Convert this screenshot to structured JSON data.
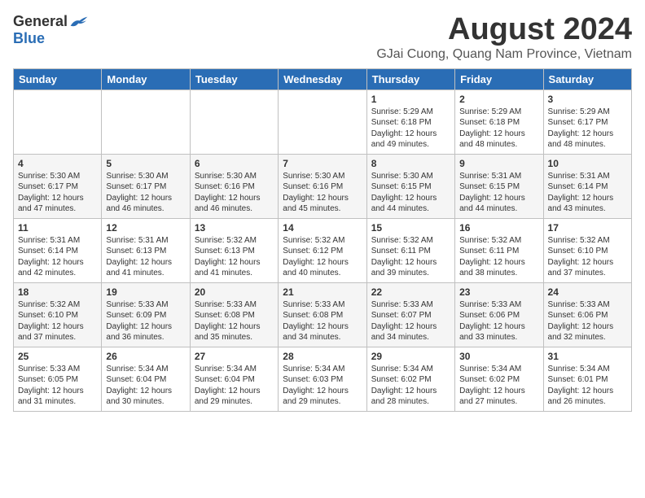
{
  "header": {
    "logo_general": "General",
    "logo_blue": "Blue",
    "month_title": "August 2024",
    "location": "GJai Cuong, Quang Nam Province, Vietnam"
  },
  "calendar": {
    "days_of_week": [
      "Sunday",
      "Monday",
      "Tuesday",
      "Wednesday",
      "Thursday",
      "Friday",
      "Saturday"
    ],
    "weeks": [
      [
        {
          "day": "",
          "info": ""
        },
        {
          "day": "",
          "info": ""
        },
        {
          "day": "",
          "info": ""
        },
        {
          "day": "",
          "info": ""
        },
        {
          "day": "1",
          "info": "Sunrise: 5:29 AM\nSunset: 6:18 PM\nDaylight: 12 hours\nand 49 minutes."
        },
        {
          "day": "2",
          "info": "Sunrise: 5:29 AM\nSunset: 6:18 PM\nDaylight: 12 hours\nand 48 minutes."
        },
        {
          "day": "3",
          "info": "Sunrise: 5:29 AM\nSunset: 6:17 PM\nDaylight: 12 hours\nand 48 minutes."
        }
      ],
      [
        {
          "day": "4",
          "info": "Sunrise: 5:30 AM\nSunset: 6:17 PM\nDaylight: 12 hours\nand 47 minutes."
        },
        {
          "day": "5",
          "info": "Sunrise: 5:30 AM\nSunset: 6:17 PM\nDaylight: 12 hours\nand 46 minutes."
        },
        {
          "day": "6",
          "info": "Sunrise: 5:30 AM\nSunset: 6:16 PM\nDaylight: 12 hours\nand 46 minutes."
        },
        {
          "day": "7",
          "info": "Sunrise: 5:30 AM\nSunset: 6:16 PM\nDaylight: 12 hours\nand 45 minutes."
        },
        {
          "day": "8",
          "info": "Sunrise: 5:30 AM\nSunset: 6:15 PM\nDaylight: 12 hours\nand 44 minutes."
        },
        {
          "day": "9",
          "info": "Sunrise: 5:31 AM\nSunset: 6:15 PM\nDaylight: 12 hours\nand 44 minutes."
        },
        {
          "day": "10",
          "info": "Sunrise: 5:31 AM\nSunset: 6:14 PM\nDaylight: 12 hours\nand 43 minutes."
        }
      ],
      [
        {
          "day": "11",
          "info": "Sunrise: 5:31 AM\nSunset: 6:14 PM\nDaylight: 12 hours\nand 42 minutes."
        },
        {
          "day": "12",
          "info": "Sunrise: 5:31 AM\nSunset: 6:13 PM\nDaylight: 12 hours\nand 41 minutes."
        },
        {
          "day": "13",
          "info": "Sunrise: 5:32 AM\nSunset: 6:13 PM\nDaylight: 12 hours\nand 41 minutes."
        },
        {
          "day": "14",
          "info": "Sunrise: 5:32 AM\nSunset: 6:12 PM\nDaylight: 12 hours\nand 40 minutes."
        },
        {
          "day": "15",
          "info": "Sunrise: 5:32 AM\nSunset: 6:11 PM\nDaylight: 12 hours\nand 39 minutes."
        },
        {
          "day": "16",
          "info": "Sunrise: 5:32 AM\nSunset: 6:11 PM\nDaylight: 12 hours\nand 38 minutes."
        },
        {
          "day": "17",
          "info": "Sunrise: 5:32 AM\nSunset: 6:10 PM\nDaylight: 12 hours\nand 37 minutes."
        }
      ],
      [
        {
          "day": "18",
          "info": "Sunrise: 5:32 AM\nSunset: 6:10 PM\nDaylight: 12 hours\nand 37 minutes."
        },
        {
          "day": "19",
          "info": "Sunrise: 5:33 AM\nSunset: 6:09 PM\nDaylight: 12 hours\nand 36 minutes."
        },
        {
          "day": "20",
          "info": "Sunrise: 5:33 AM\nSunset: 6:08 PM\nDaylight: 12 hours\nand 35 minutes."
        },
        {
          "day": "21",
          "info": "Sunrise: 5:33 AM\nSunset: 6:08 PM\nDaylight: 12 hours\nand 34 minutes."
        },
        {
          "day": "22",
          "info": "Sunrise: 5:33 AM\nSunset: 6:07 PM\nDaylight: 12 hours\nand 34 minutes."
        },
        {
          "day": "23",
          "info": "Sunrise: 5:33 AM\nSunset: 6:06 PM\nDaylight: 12 hours\nand 33 minutes."
        },
        {
          "day": "24",
          "info": "Sunrise: 5:33 AM\nSunset: 6:06 PM\nDaylight: 12 hours\nand 32 minutes."
        }
      ],
      [
        {
          "day": "25",
          "info": "Sunrise: 5:33 AM\nSunset: 6:05 PM\nDaylight: 12 hours\nand 31 minutes."
        },
        {
          "day": "26",
          "info": "Sunrise: 5:34 AM\nSunset: 6:04 PM\nDaylight: 12 hours\nand 30 minutes."
        },
        {
          "day": "27",
          "info": "Sunrise: 5:34 AM\nSunset: 6:04 PM\nDaylight: 12 hours\nand 29 minutes."
        },
        {
          "day": "28",
          "info": "Sunrise: 5:34 AM\nSunset: 6:03 PM\nDaylight: 12 hours\nand 29 minutes."
        },
        {
          "day": "29",
          "info": "Sunrise: 5:34 AM\nSunset: 6:02 PM\nDaylight: 12 hours\nand 28 minutes."
        },
        {
          "day": "30",
          "info": "Sunrise: 5:34 AM\nSunset: 6:02 PM\nDaylight: 12 hours\nand 27 minutes."
        },
        {
          "day": "31",
          "info": "Sunrise: 5:34 AM\nSunset: 6:01 PM\nDaylight: 12 hours\nand 26 minutes."
        }
      ]
    ]
  }
}
